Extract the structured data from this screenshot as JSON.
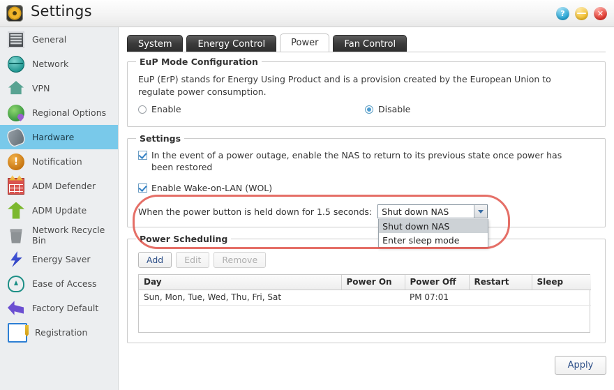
{
  "window": {
    "title": "Settings",
    "icon": "settings-gear-icon",
    "controls": [
      {
        "name": "help-button",
        "glyph": "?"
      },
      {
        "name": "minimize-button",
        "glyph": "—"
      },
      {
        "name": "close-button",
        "glyph": "✕"
      }
    ]
  },
  "sidebar": {
    "items": [
      {
        "label": "General",
        "icon": "server-rack-icon",
        "active": false
      },
      {
        "label": "Network",
        "icon": "globe-network-icon",
        "active": false
      },
      {
        "label": "VPN",
        "icon": "vpn-house-icon",
        "active": false
      },
      {
        "label": "Regional Options",
        "icon": "globe-pin-icon",
        "active": false
      },
      {
        "label": "Hardware",
        "icon": "hardware-chip-icon",
        "active": true
      },
      {
        "label": "Notification",
        "icon": "notification-alert-icon",
        "active": false
      },
      {
        "label": "ADM Defender",
        "icon": "firewall-icon",
        "active": false
      },
      {
        "label": "ADM Update",
        "icon": "up-arrow-icon",
        "active": false
      },
      {
        "label": "Network Recycle Bin",
        "icon": "trash-bin-icon",
        "active": false
      },
      {
        "label": "Energy Saver",
        "icon": "lightning-bolt-icon",
        "active": false
      },
      {
        "label": "Ease of Access",
        "icon": "cloud-upload-icon",
        "active": false
      },
      {
        "label": "Factory Default",
        "icon": "undo-arrow-icon",
        "active": false
      },
      {
        "label": "Registration",
        "icon": "clipboard-pencil-icon",
        "active": false
      }
    ]
  },
  "tabs": [
    {
      "label": "System",
      "active": false
    },
    {
      "label": "Energy Control",
      "active": false
    },
    {
      "label": "Power",
      "active": true
    },
    {
      "label": "Fan Control",
      "active": false
    }
  ],
  "eup": {
    "legend": "EuP Mode Configuration",
    "description": "EuP (ErP) stands for Energy Using Product and is a provision created by the European Union to regulate power consumption.",
    "options": [
      {
        "label": "Enable",
        "selected": false
      },
      {
        "label": "Disable",
        "selected": true
      }
    ]
  },
  "settings": {
    "legend": "Settings",
    "checkboxes": [
      {
        "label": "In the event of a power outage, enable the NAS to return to its previous state once power has been restored",
        "checked": true
      },
      {
        "label": "Enable Wake-on-LAN (WOL)",
        "checked": true
      }
    ],
    "power_button": {
      "label": "When the power button is held down for 1.5 seconds:",
      "value": "Shut down NAS",
      "open": true,
      "options": [
        {
          "label": "Shut down NAS",
          "highlighted": true
        },
        {
          "label": "Enter sleep mode",
          "highlighted": false
        }
      ]
    }
  },
  "scheduling": {
    "legend": "Power Scheduling",
    "buttons": [
      {
        "label": "Add",
        "enabled": true
      },
      {
        "label": "Edit",
        "enabled": false
      },
      {
        "label": "Remove",
        "enabled": false
      }
    ],
    "columns": [
      "Day",
      "Power On",
      "Power Off",
      "Restart",
      "Sleep"
    ],
    "rows": [
      {
        "day": "Sun, Mon, Tue, Wed, Thu, Fri, Sat",
        "power_on": "",
        "power_off": "PM 07:01",
        "restart": "",
        "sleep": ""
      }
    ]
  },
  "footer": {
    "apply_label": "Apply"
  },
  "annotation": {
    "shape": "red-ellipse-highlight",
    "color": "#e0564c"
  }
}
